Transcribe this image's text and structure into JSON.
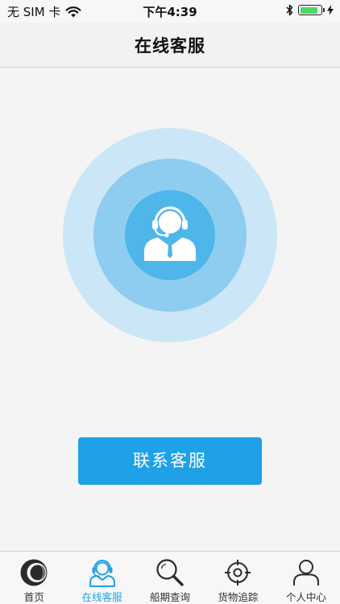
{
  "status_bar": {
    "carrier": "无 SIM 卡",
    "time": "下午4:39",
    "battery_level": 0.85,
    "battery_color": "#4cd964",
    "icons": [
      "wifi-icon",
      "bluetooth-icon",
      "battery-icon",
      "charging-bolt-icon"
    ]
  },
  "nav": {
    "title": "在线客服"
  },
  "main": {
    "illustration_icon": "customer-service-agent-icon",
    "contact_button_label": "联系客服",
    "colors": {
      "ring_outer": "#cbe6f6",
      "ring_middle": "#8fcdf0",
      "ring_inner": "#4fb6ea",
      "button": "#1ea1e6"
    }
  },
  "tab_bar": {
    "active_index": 1,
    "active_color": "#1ea1e6",
    "tabs": [
      {
        "label": "首页",
        "icon": "home-icon"
      },
      {
        "label": "在线客服",
        "icon": "headset-agent-icon"
      },
      {
        "label": "船期查询",
        "icon": "search-icon"
      },
      {
        "label": "货物追踪",
        "icon": "crosshair-icon"
      },
      {
        "label": "个人中心",
        "icon": "user-icon"
      }
    ]
  }
}
